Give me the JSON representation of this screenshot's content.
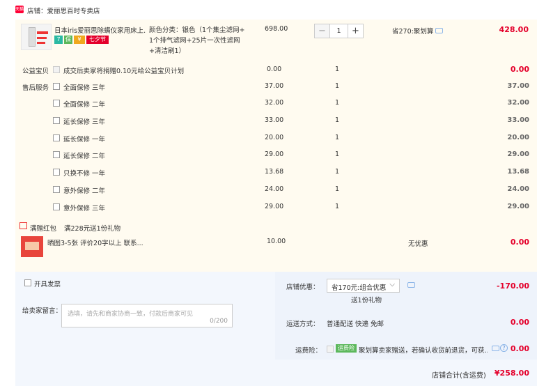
{
  "store": {
    "label": "店铺：爱丽思百时专卖店",
    "badge": "天猫"
  },
  "product": {
    "title": "日本iris爱丽思除螨仪家用床上...",
    "spec_line1": "颜色分类：银色（1个集尘滤网+",
    "spec_line2": "1个排气滤网+25片一次性滤网",
    "spec_line3": "+清洁刷1）",
    "price": "698.00",
    "qty": "1",
    "discount": "省270:聚划算",
    "subtotal": "428.00",
    "badges": {
      "b1": "7",
      "b2": "保",
      "b3": "¥",
      "b4": "七夕节"
    }
  },
  "charity": {
    "label": "公益宝贝",
    "text": "成交后卖家将捐赠0.10元给公益宝贝计划",
    "price": "0.00",
    "qty": "1",
    "subtotal": "0.00"
  },
  "service": {
    "label": "售后服务",
    "items": [
      {
        "name": "全面保修 三年",
        "price": "37.00",
        "qty": "1",
        "subtotal": "37.00"
      },
      {
        "name": "全面保修 二年",
        "price": "32.00",
        "qty": "1",
        "subtotal": "32.00"
      },
      {
        "name": "延长保修 三年",
        "price": "33.00",
        "qty": "1",
        "subtotal": "33.00"
      },
      {
        "name": "延长保修 一年",
        "price": "20.00",
        "qty": "1",
        "subtotal": "20.00"
      },
      {
        "name": "延长保修 二年",
        "price": "29.00",
        "qty": "1",
        "subtotal": "29.00"
      },
      {
        "name": "只换不修 一年",
        "price": "13.68",
        "qty": "1",
        "subtotal": "13.68"
      },
      {
        "name": "意外保修 二年",
        "price": "24.00",
        "qty": "1",
        "subtotal": "24.00"
      },
      {
        "name": "意外保修 三年",
        "price": "29.00",
        "qty": "1",
        "subtotal": "29.00"
      }
    ]
  },
  "gift": {
    "header_label": "满赠红包",
    "header_text": "满228元送1份礼物",
    "item_title": "晒图3-5张 评价20字以上 联系...",
    "price": "10.00",
    "promo": "无优惠",
    "subtotal": "0.00"
  },
  "invoice": {
    "label": "开具发票"
  },
  "message": {
    "label": "给卖家留言：",
    "placeholder": "选填，请先和商家协商一致，付款后商家可见",
    "counter": "0/200"
  },
  "store_discount": {
    "label": "店铺优惠：",
    "selected": "省170元:组合优惠",
    "sub": "送1份礼物",
    "amount": "-170.00"
  },
  "shipping": {
    "label": "运送方式：",
    "value": "普通配送 快递 免邮",
    "amount": "0.00"
  },
  "freight_insurance": {
    "label": "运费险：",
    "badge": "运费险",
    "text": "聚划算卖家赠送，若确认收货前退货，可获...",
    "amount": "0.00"
  },
  "total": {
    "label": "店铺合计(含运费)",
    "amount": "¥258.00"
  },
  "colors": {
    "red": "#e4002b",
    "bg_light": "#fffbf0",
    "bg_blue": "#eef3fb",
    "teal": "#2bb9a3",
    "green": "#5cb85c"
  }
}
